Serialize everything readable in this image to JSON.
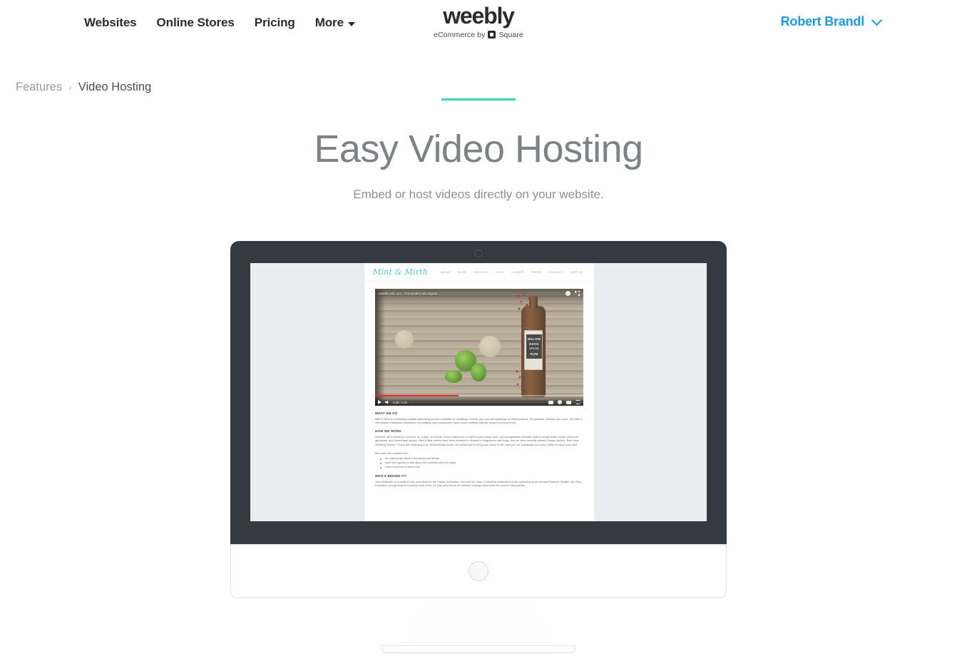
{
  "topnav": {
    "links": [
      {
        "label": "Websites"
      },
      {
        "label": "Online Stores"
      },
      {
        "label": "Pricing"
      },
      {
        "label": "More"
      }
    ],
    "logo": {
      "word": "weebly",
      "tagline_pre": "eCommerce by",
      "tagline_post": "Square",
      "square_icon": "square-logo-icon"
    },
    "user": {
      "name": "Robert Brandl",
      "chevron_icon": "chevron-down-icon"
    }
  },
  "breadcrumb": {
    "parent": "Features",
    "separator": "›",
    "current": "Video Hosting"
  },
  "hero": {
    "accent_color": "#3ad3c4",
    "title": "Easy Video Hosting",
    "subtitle": "Embed or host videos directly on your website."
  },
  "monitor": {
    "camera_icon": "camera-dot-icon",
    "home_button_icon": "home-button-icon"
  },
  "preview_site": {
    "logo": "Mint & Mirth",
    "nav": [
      "ABOUT",
      "BLOG",
      "SERVICES",
      "SHOP",
      "CLIENTS",
      "PRESS",
      "CONTACT",
      "CART (0)"
    ],
    "video": {
      "title": "Janelle and Joni - The Modern Mixologists",
      "timestamp": "0:39 / 1:14",
      "progress_percent": 40,
      "progress_color": "#e22b2b",
      "play_icon": "play-icon",
      "volume_icon": "volume-icon",
      "watch_later_icon": "watch-later-icon",
      "share_icon": "share-icon",
      "captions_icon": "captions-icon",
      "settings_icon": "settings-gear-icon",
      "theater_icon": "theater-mode-icon",
      "fullscreen_icon": "fullscreen-icon",
      "bottle_label_line1": "BELOW",
      "bottle_label_line2": "DECK",
      "bottle_label_line3": "SPICED",
      "bottle_label_line4": "RUM"
    },
    "sections": [
      {
        "heading": "WHAT WE DO",
        "body": "Mint & Mirth is a traveling cocktail bartending service available for weddings, events, pop-ups and openings at retail locations, art galleries, markets and more. We offer a memorable interactive experience by creating fully customized, hyper-local cocktails that are unique to every event."
      },
      {
        "heading": "HOW WE WORK",
        "body": "Whether we're serving in a forest, on a farm, on a boat, in the boardroom, or right in your living room, our unforgettable cocktails feature locally made spirits, seasonal garnishes, and homemade syrups. Mint & Mirth drinks have been featured in dozens of magazines and blogs, and we were recently named Oregon Bride's \"Best New Wedding Vendor\"! If you are dreaming of an extraordinary event, we would love to bring your vision to life, and yes, we coordinate our party outfits to match your vibe."
      }
    ],
    "list_intro": "We work with couples who...",
    "list_items": [
      "are passionate about their drinks and details",
      "want their guests to talk about the cocktails after the party",
      "want more than a soda crew"
    ],
    "last_section": {
      "heading": "WHO'S BEHIND IT?",
      "body": "Joni Whitworth is a creative born and raised in the Pacific Northwest. She and her team of traveling bartenders most commonly serve around Portland, Seattle, and San Francisco, though they've traveled most of the US (last year as far as Ireland!) helping hosts throw the world's best parties."
    }
  }
}
